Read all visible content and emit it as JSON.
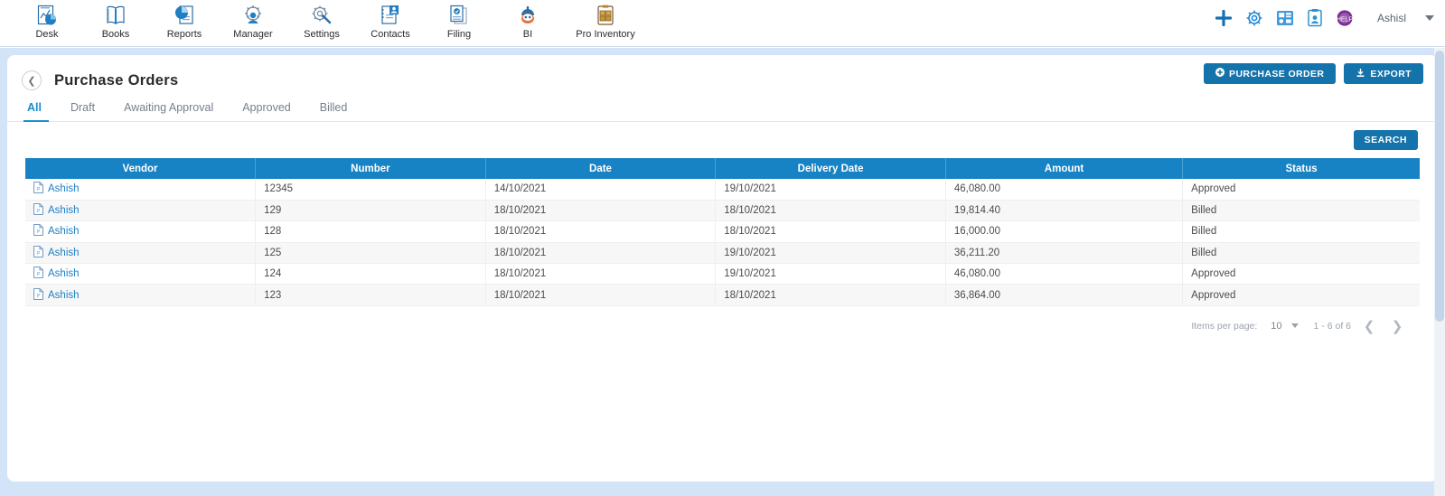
{
  "app_toolbar": {
    "items": [
      {
        "label": "Desk",
        "icon": "desk-chart-icon"
      },
      {
        "label": "Books",
        "icon": "open-book-icon"
      },
      {
        "label": "Reports",
        "icon": "pie-chart-report-icon"
      },
      {
        "label": "Manager",
        "icon": "gear-person-icon"
      },
      {
        "label": "Settings",
        "icon": "gear-wrench-icon"
      },
      {
        "label": "Contacts",
        "icon": "contact-card-icon"
      },
      {
        "label": "Filing",
        "icon": "document-stack-icon"
      },
      {
        "label": "BI",
        "icon": "bi-robot-icon"
      },
      {
        "label": "Pro Inventory",
        "icon": "inventory-clipboard-icon"
      }
    ],
    "right_icons": [
      {
        "name": "add-plus-icon"
      },
      {
        "name": "gear-icon"
      },
      {
        "name": "dashboard-grid-icon"
      },
      {
        "name": "notes-icon"
      },
      {
        "name": "help-circle-icon"
      }
    ],
    "username": "Ashisl"
  },
  "page": {
    "title": "Purchase Orders",
    "back_icon": "chevron-left-icon",
    "actions": [
      {
        "label": "PURCHASE ORDER",
        "icon": "plus-circle-icon",
        "name": "purchase-order-button"
      },
      {
        "label": "EXPORT",
        "icon": "download-icon",
        "name": "export-button"
      }
    ],
    "tabs": [
      {
        "label": "All",
        "active": true
      },
      {
        "label": "Draft",
        "active": false
      },
      {
        "label": "Awaiting Approval",
        "active": false
      },
      {
        "label": "Approved",
        "active": false
      },
      {
        "label": "Billed",
        "active": false
      }
    ],
    "search_label": "SEARCH"
  },
  "table": {
    "columns": [
      "Vendor",
      "Number",
      "Date",
      "Delivery Date",
      "Amount",
      "Status"
    ],
    "rows": [
      {
        "vendor": "Ashish",
        "number": "12345",
        "date": "14/10/2021",
        "delivery_date": "19/10/2021",
        "amount": "46,080.00",
        "status": "Approved"
      },
      {
        "vendor": "Ashish",
        "number": "129",
        "date": "18/10/2021",
        "delivery_date": "18/10/2021",
        "amount": "19,814.40",
        "status": "Billed"
      },
      {
        "vendor": "Ashish",
        "number": "128",
        "date": "18/10/2021",
        "delivery_date": "18/10/2021",
        "amount": "16,000.00",
        "status": "Billed"
      },
      {
        "vendor": "Ashish",
        "number": "125",
        "date": "18/10/2021",
        "delivery_date": "19/10/2021",
        "amount": "36,211.20",
        "status": "Billed"
      },
      {
        "vendor": "Ashish",
        "number": "124",
        "date": "18/10/2021",
        "delivery_date": "19/10/2021",
        "amount": "46,080.00",
        "status": "Approved"
      },
      {
        "vendor": "Ashish",
        "number": "123",
        "date": "18/10/2021",
        "delivery_date": "18/10/2021",
        "amount": "36,864.00",
        "status": "Approved"
      }
    ]
  },
  "paginator": {
    "items_per_page_label": "Items per page:",
    "items_per_page_value": "10",
    "range_label": "1 - 6 of 6",
    "prev_icon": "chevron-left-icon",
    "next_icon": "chevron-right-icon"
  },
  "colors": {
    "brand_blue": "#1573ab",
    "table_header_blue": "#1783c4",
    "tab_active": "#1b8ccc",
    "page_bg": "#d3e3f8",
    "link": "#1d7fc3"
  }
}
